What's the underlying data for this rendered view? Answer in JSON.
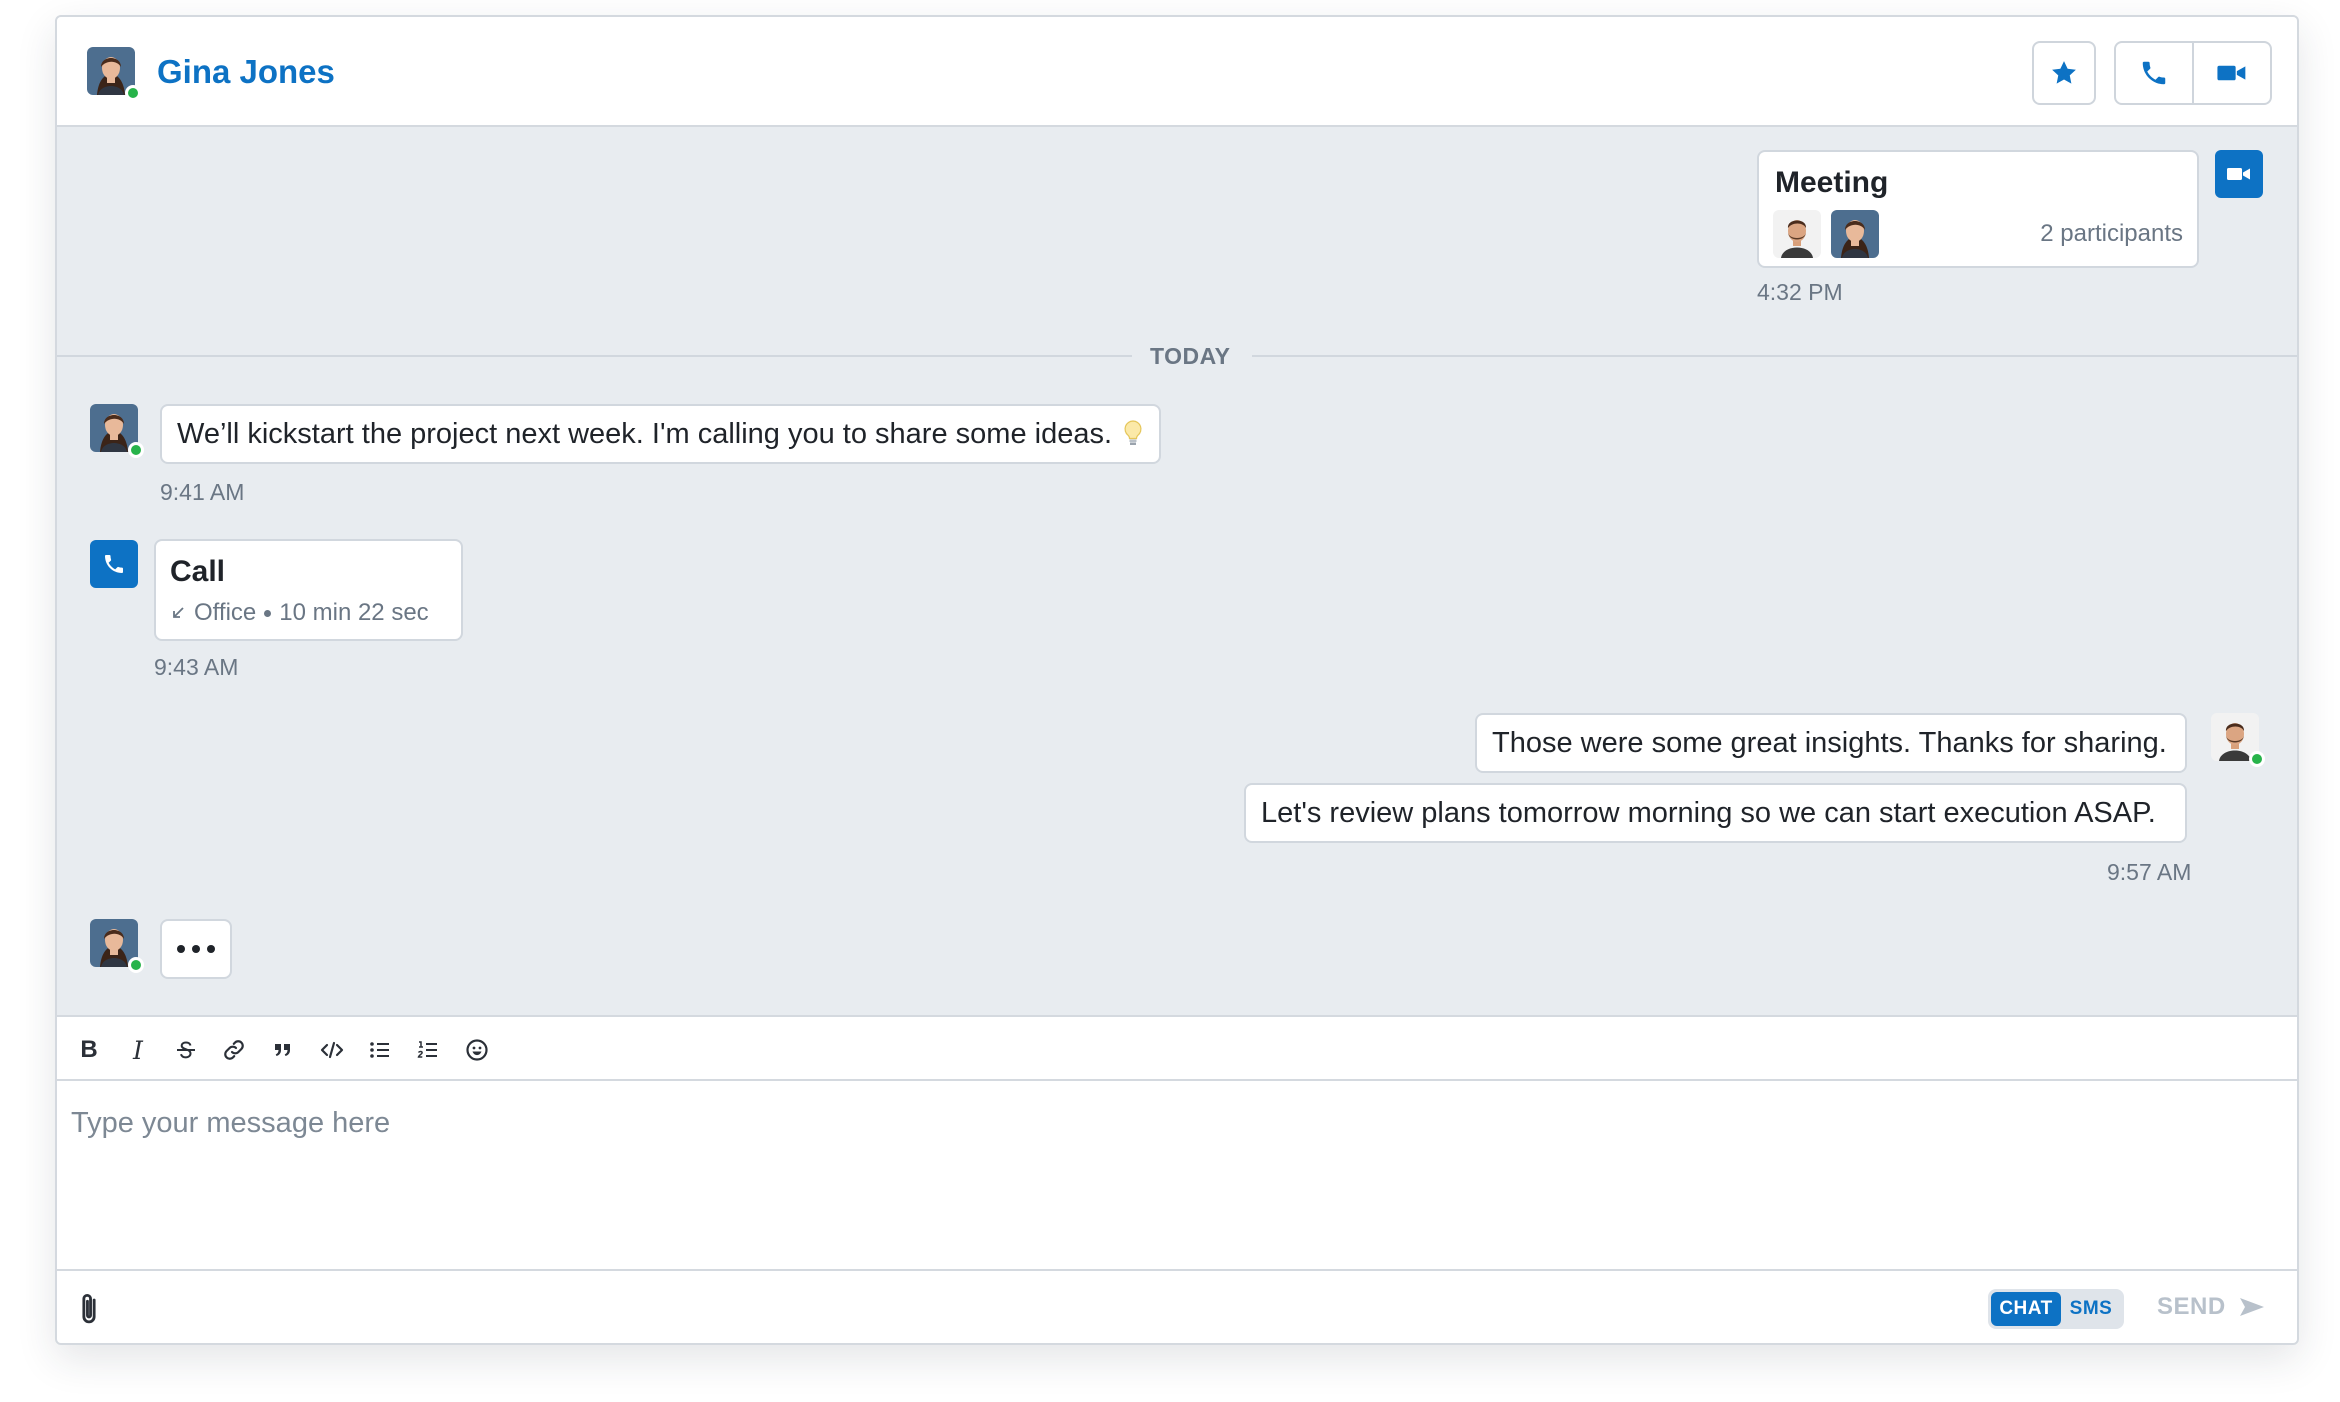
{
  "header": {
    "contact_name": "Gina Jones",
    "contact_online": true,
    "actions": {
      "favorite": "star-icon",
      "call": "phone-icon",
      "video": "video-icon"
    }
  },
  "messages": {
    "meeting": {
      "title": "Meeting",
      "participants": "2 participants",
      "time": "4:32 PM"
    },
    "divider": "TODAY",
    "incoming_1": {
      "text": "We’ll kickstart the project next week. I'm calling you to share some ideas.",
      "time": "9:41 AM"
    },
    "call": {
      "title": "Call",
      "location": "Office",
      "duration": "10 min 22 sec",
      "time": "9:43 AM"
    },
    "outgoing": {
      "line_1": "Those were some great insights. Thanks for sharing.",
      "line_2": "Let's review plans tomorrow morning so we can start execution ASAP.",
      "time": "9:57 AM"
    }
  },
  "composer": {
    "toolbar": [
      "bold-icon",
      "italic-icon",
      "strikethrough-icon",
      "link-icon",
      "quote-icon",
      "code-icon",
      "bullet-list-icon",
      "numbered-list-icon",
      "emoji-icon"
    ],
    "bold_label": "B",
    "italic_label": "I",
    "placeholder": "Type your message here",
    "mode_chat": "CHAT",
    "mode_sms": "SMS",
    "active_mode": "CHAT",
    "send_label": "SEND"
  },
  "colors": {
    "accent": "#0d72c4",
    "background": "#e8ecf0",
    "online": "#27b34a",
    "muted_text": "#6a7684"
  }
}
